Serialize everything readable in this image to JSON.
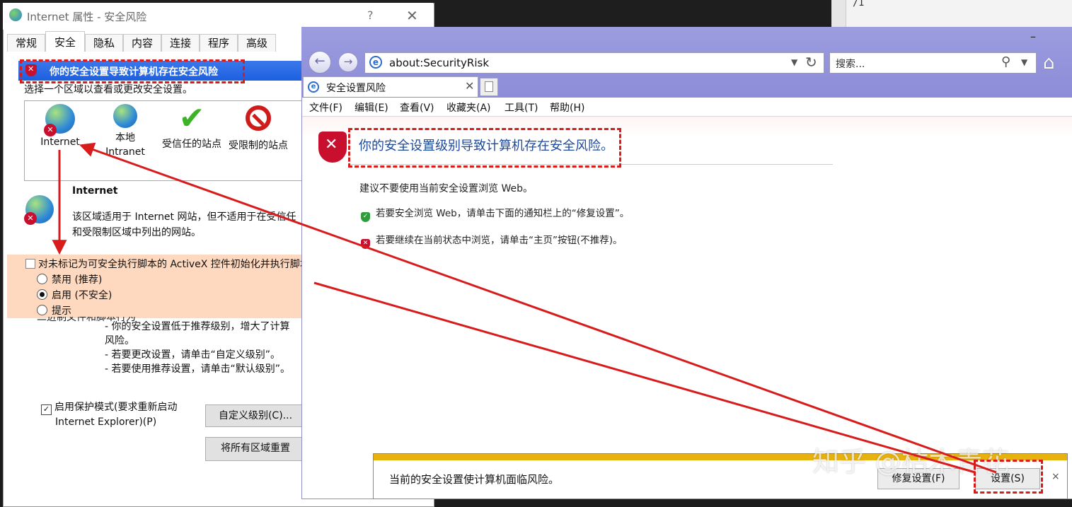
{
  "background": {
    "right_pane_text": "/I"
  },
  "dialog": {
    "title": "Internet 属性 - 安全风险",
    "help": "?",
    "close": "✕",
    "tabs": [
      "常规",
      "安全",
      "隐私",
      "内容",
      "连接",
      "程序",
      "高级"
    ],
    "active_tab": "安全",
    "banner": "你的安全设置导致计算机存在安全风险",
    "zone_prompt": "选择一个区域以查看或更改安全设置。",
    "zones": [
      {
        "label": "Internet",
        "icon": "globe-risk-icon"
      },
      {
        "label": "本地\nIntranet",
        "icon": "local-intranet-icon"
      },
      {
        "label": "受信任的站点",
        "icon": "trusted-check-icon"
      },
      {
        "label": "受限制的站点",
        "icon": "restricted-icon"
      }
    ],
    "zone_info_title": "Internet",
    "zone_info_desc": "该区域适用于 Internet 网站，但不适用于在受信任和受限制区域中列出的网站。",
    "activex_setting": {
      "header": "对未标记为可安全执行脚本的 ActiveX 控件初始化并执行脚本 (不安全",
      "options": [
        "禁用 (推荐)",
        "启用 (不安全)",
        "提示"
      ],
      "selected": "启用 (不安全)"
    },
    "struck_line": "二进制文件和脚本行为",
    "level_text": [
      "- 你的安全设置低于推荐级别，增大了计算",
      "风险。",
      "- 若要更改设置，请单击“自定义级别”。",
      "- 若要使用推荐设置，请单击“默认级别”。"
    ],
    "protected_mode_line1": "启用保护模式(要求重新启动",
    "protected_mode_line2": "Internet Explorer)(P)",
    "custom_level_button": "自定义级别(C)...",
    "reset_all_button": "将所有区域重置"
  },
  "ie": {
    "minimize": "–",
    "address": "about:SecurityRisk",
    "search_placeholder": "搜索...",
    "tab_title": "安全设置风险",
    "menu": [
      "文件(F)",
      "编辑(E)",
      "查看(V)",
      "收藏夹(A)",
      "工具(T)",
      "帮助(H)"
    ],
    "risk_title": "你的安全设置级别导致计算机存在安全风险。",
    "advice": "建议不要使用当前安全设置浏览 Web。",
    "tip1": "若要安全浏览 Web，请单击下面的通知栏上的“修复设置”。",
    "tip2": "若要继续在当前状态中浏览，请单击“主页”按钮(不推荐)。",
    "notify_message": "当前的安全设置使计算机面临风险。",
    "fix_button": "修复设置(F)",
    "settings_button": "设置(S)",
    "notify_close": "×"
  },
  "watermark": "知乎 @枯木青花",
  "colors": {
    "banner_blue": "#1d5fe0",
    "annotation_red": "#d81b1b",
    "ie_chrome": "#9c9ce0",
    "activex_highlight": "#ffd9bf",
    "notify_bar": "#e8b20e"
  }
}
